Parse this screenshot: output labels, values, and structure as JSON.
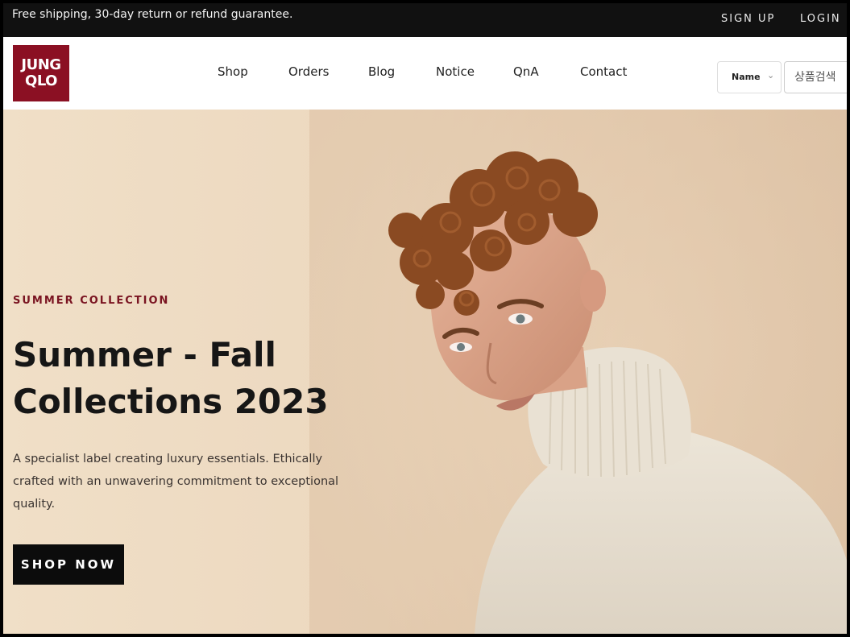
{
  "topbar": {
    "shipping_text": "Free shipping, 30-day return or refund guarantee.",
    "signup_label": "SIGN UP",
    "login_label": "LOGIN"
  },
  "header": {
    "logo_line1": "JUNG",
    "logo_line2": "QLO",
    "nav": [
      "Shop",
      "Orders",
      "Blog",
      "Notice",
      "QnA",
      "Contact"
    ],
    "search_select_value": "Name",
    "search_placeholder": "상품검색"
  },
  "hero": {
    "eyebrow": "SUMMER COLLECTION",
    "title_line1": "Summer - Fall",
    "title_line2": "Collections 2023",
    "description": "A specialist label creating luxury essentials. Ethically crafted with an unwavering commitment to exceptional quality.",
    "cta_label": "SHOP NOW"
  },
  "colors": {
    "brand": "#8b1023",
    "topbar_bg": "#111111",
    "hero_bg": "#efdcc5",
    "cta_bg": "#0c0c0c"
  },
  "icons": {
    "select_chevron": "chevron-down-icon"
  }
}
